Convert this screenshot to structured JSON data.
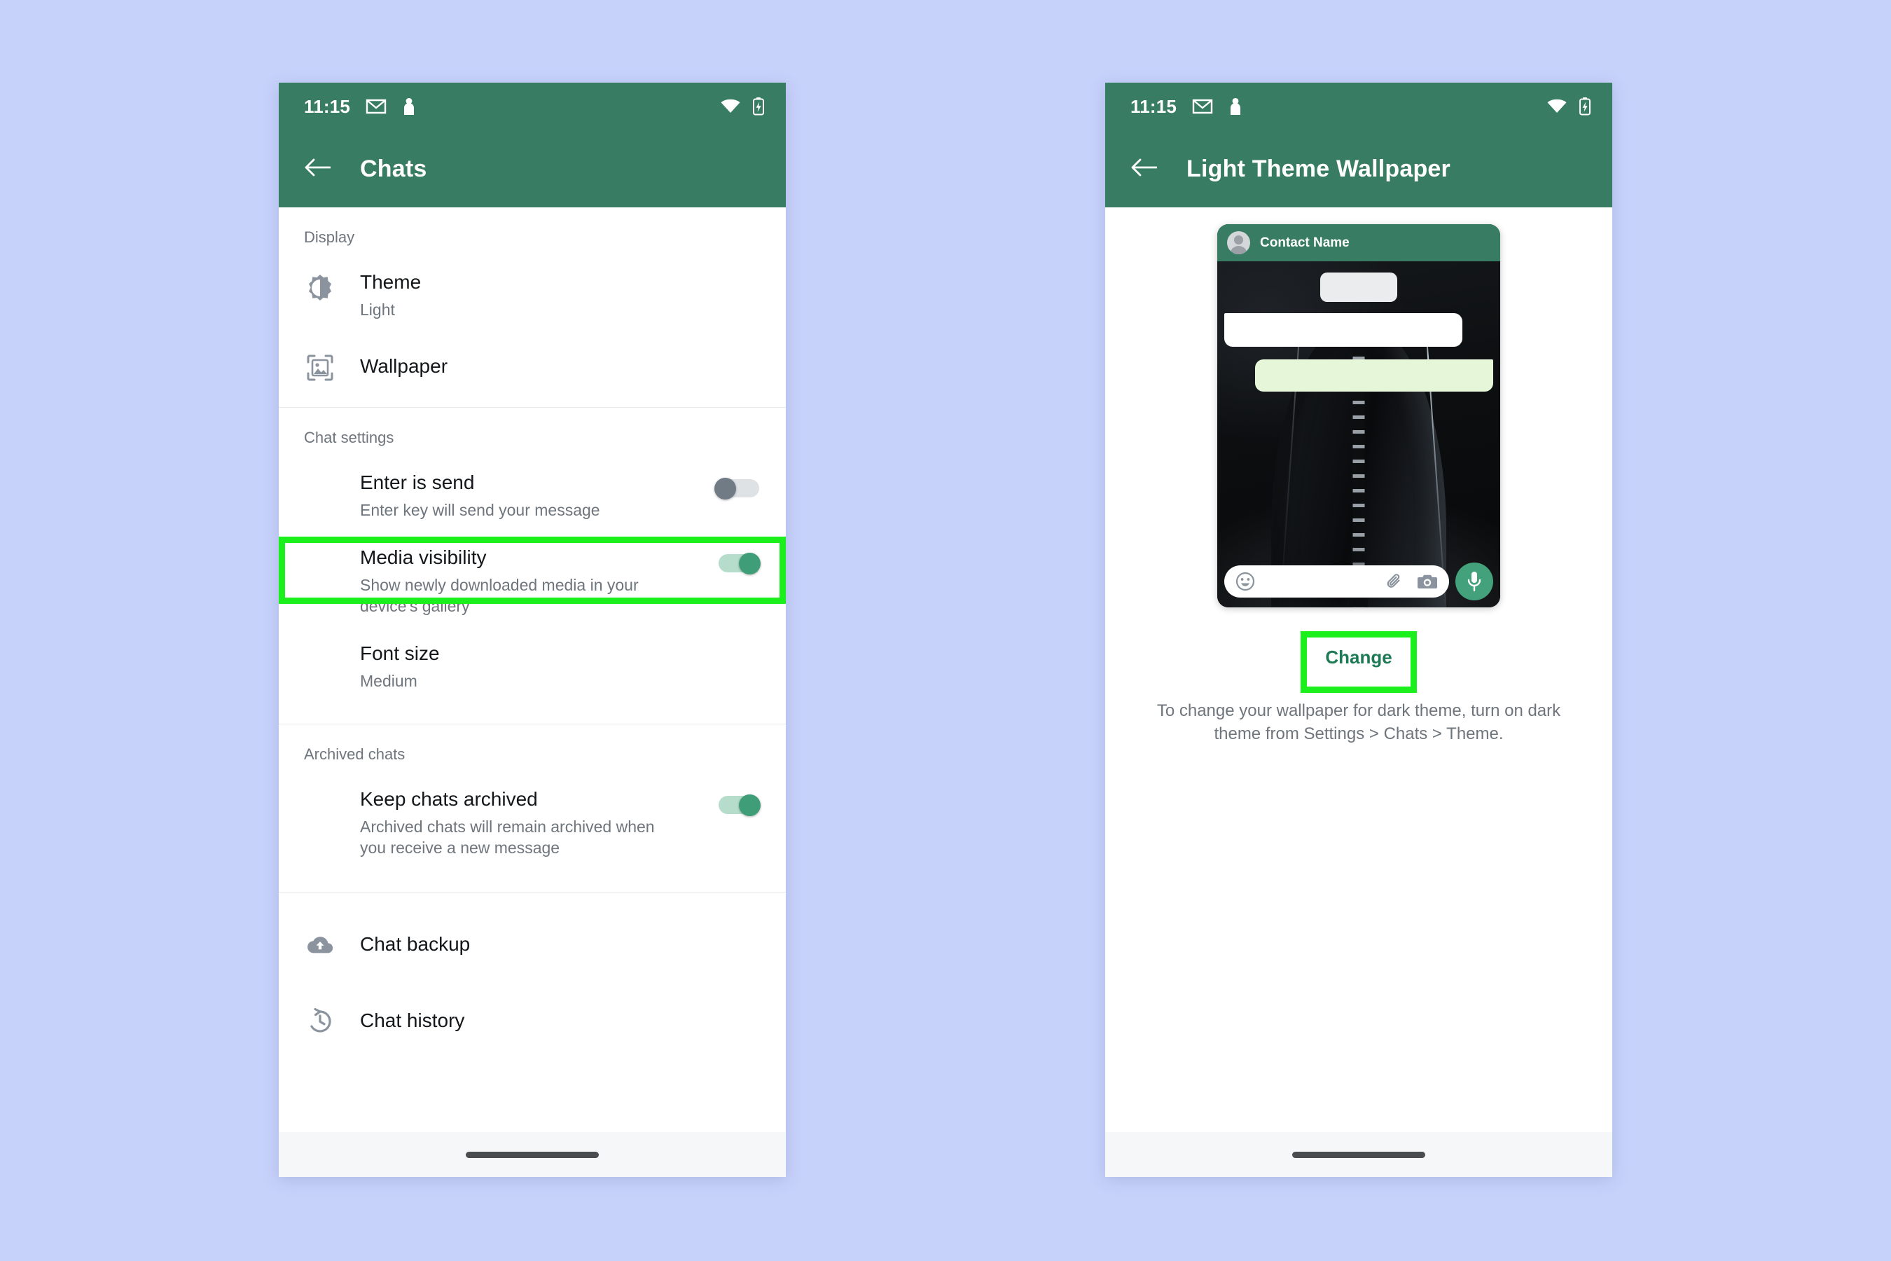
{
  "theme": {
    "page_background": "#c7d2fb",
    "header_green": "#387d63",
    "accent_green": "#43a17c",
    "highlight_green": "#1cf01c",
    "link_green": "#1d7a55"
  },
  "status_bar": {
    "time": "11:15",
    "icons": [
      "gmail-icon",
      "person-icon",
      "wifi-icon",
      "battery-charging-icon"
    ]
  },
  "left_phone": {
    "app_bar": {
      "back_icon": "back-arrow-icon",
      "title": "Chats"
    },
    "sections": [
      {
        "label": "Display",
        "rows": [
          {
            "icon": "brightness-icon",
            "title": "Theme",
            "subtitle": "Light"
          },
          {
            "icon": "wallpaper-icon",
            "title": "Wallpaper",
            "subtitle": "",
            "highlighted": true
          }
        ]
      },
      {
        "label": "Chat settings",
        "rows": [
          {
            "icon": "",
            "title": "Enter is send",
            "subtitle": "Enter key will send your message",
            "toggle": "off"
          },
          {
            "icon": "",
            "title": "Media visibility",
            "subtitle": "Show newly downloaded media in your device's gallery",
            "toggle": "on"
          },
          {
            "icon": "",
            "title": "Font size",
            "subtitle": "Medium"
          }
        ]
      },
      {
        "label": "Archived chats",
        "rows": [
          {
            "icon": "",
            "title": "Keep chats archived",
            "subtitle": "Archived chats will remain archived when you receive a new message",
            "toggle": "on"
          }
        ]
      },
      {
        "label": "",
        "rows": [
          {
            "icon": "cloud-upload-icon",
            "title": "Chat backup",
            "subtitle": ""
          },
          {
            "icon": "history-icon",
            "title": "Chat history",
            "subtitle": ""
          }
        ]
      }
    ]
  },
  "right_phone": {
    "app_bar": {
      "back_icon": "back-arrow-icon",
      "title": "Light Theme Wallpaper"
    },
    "preview": {
      "contact_name": "Contact Name",
      "avatar_icon": "person-avatar-icon",
      "input_icons": [
        "emoji-icon",
        "paperclip-icon",
        "camera-icon"
      ],
      "mic_icon": "microphone-icon",
      "wallpaper_description": "dark photo of a pointed tower at night"
    },
    "change_button": "Change",
    "footnote": "To change your wallpaper for dark theme, turn on dark theme from Settings > Chats > Theme."
  }
}
